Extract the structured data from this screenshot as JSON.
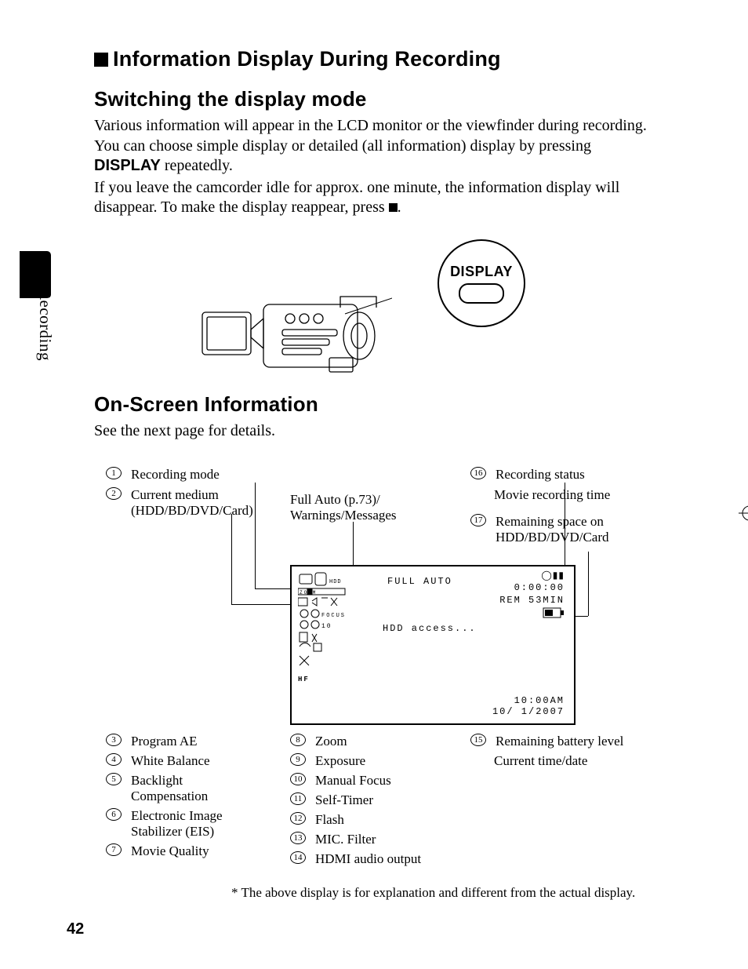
{
  "section_title": "Information Display During Recording",
  "subhead_1": "Switching the display mode",
  "para1a": "Various information will appear in the LCD monitor or the viewfinder during recording. You can choose simple display or detailed (all information) display by pressing ",
  "display_word": "DISPLAY",
  "para1b": " repeatedly.",
  "para2a": "If you leave the camcorder idle for approx. one minute, the information display will disappear. To make the display reappear, press ",
  "para2b": ".",
  "side_label": "Recording",
  "subhead_2": "On-Screen Information",
  "see_next": "See the next page for details.",
  "display_button_label": "DISPLAY",
  "lcd": {
    "full_auto": "FULL AUTO",
    "hdd_access": "HDD access...",
    "rec_indicator": "◯▮▮",
    "time_counter": "0:00:00",
    "remaining": "REM 53MIN",
    "clock_time": "10:00AM",
    "clock_date": "10/ 1/2007"
  },
  "upper_callouts": {
    "c1": {
      "n": "1",
      "label": "Recording mode"
    },
    "c2": {
      "n": "2",
      "label_l1": "Current medium",
      "label_l2": "(HDD/BD/DVD/Card)"
    },
    "mid_l1": "Full Auto (p.73)/",
    "mid_l2": "Warnings/Messages",
    "c16": {
      "n": "16",
      "label": "Recording status"
    },
    "c16b": {
      "label": "Movie recording time"
    },
    "c17": {
      "n": "17",
      "label_l1": "Remaining space on",
      "label_l2": "HDD/BD/DVD/Card"
    }
  },
  "col1": {
    "c3": {
      "n": "3",
      "label": "Program AE"
    },
    "c4": {
      "n": "4",
      "label": "White Balance"
    },
    "c5": {
      "n": "5",
      "label_l1": "Backlight",
      "label_l2": "Compensation"
    },
    "c6": {
      "n": "6",
      "label_l1": "Electronic Image",
      "label_l2": "Stabilizer (EIS)"
    },
    "c7": {
      "n": "7",
      "label": "Movie Quality"
    }
  },
  "col2": {
    "c8": {
      "n": "8",
      "label": "Zoom"
    },
    "c9": {
      "n": "9",
      "label": "Exposure"
    },
    "c10": {
      "n": "10",
      "label": "Manual Focus"
    },
    "c11": {
      "n": "11",
      "label": "Self-Timer"
    },
    "c12": {
      "n": "12",
      "label": "Flash"
    },
    "c13": {
      "n": "13",
      "label": "MIC. Filter"
    },
    "c14": {
      "n": "14",
      "label": "HDMI audio output"
    }
  },
  "col3": {
    "c15": {
      "n": "15",
      "label": "Remaining battery level"
    },
    "c15b": {
      "label": "Current time/date"
    }
  },
  "footnote": "*   The above display is for explanation and different from the actual display.",
  "page_number": "42"
}
